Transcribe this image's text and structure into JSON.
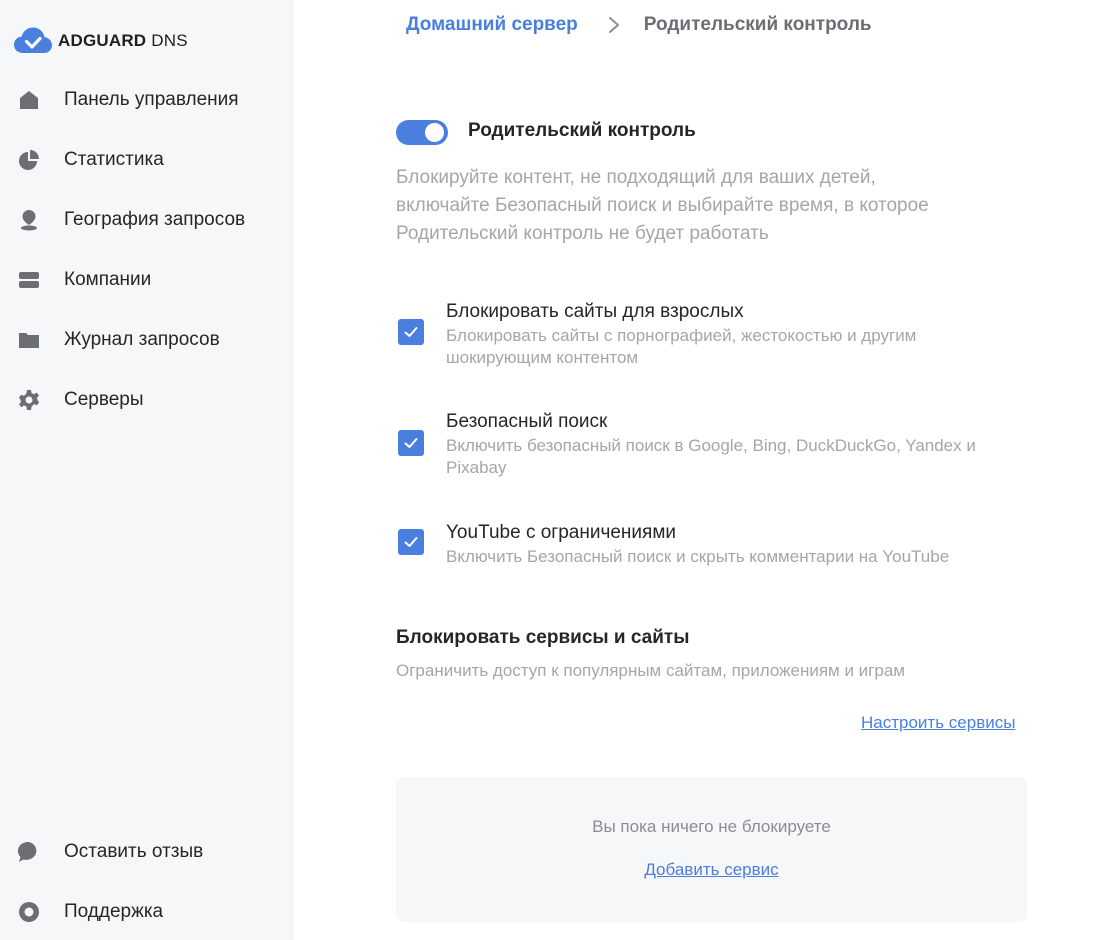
{
  "brand": {
    "name_bold": "ADGUARD",
    "name_light": "DNS",
    "logo_icon": "adguard-cloud-icon",
    "accent_color": "#4a7fe0"
  },
  "sidebar": {
    "items": [
      {
        "label": "Панель управления",
        "icon": "home-icon"
      },
      {
        "label": "Статистика",
        "icon": "pie-chart-icon"
      },
      {
        "label": "География запросов",
        "icon": "location-pin-icon"
      },
      {
        "label": "Компании",
        "icon": "server-stack-icon"
      },
      {
        "label": "Журнал запросов",
        "icon": "folder-icon"
      },
      {
        "label": "Серверы",
        "icon": "gear-icon"
      }
    ],
    "bottom_items": [
      {
        "label": "Оставить отзыв",
        "icon": "chat-bubble-icon"
      },
      {
        "label": "Поддержка",
        "icon": "lifebuoy-icon"
      }
    ]
  },
  "breadcrumb": {
    "parent": "Домашний сервер",
    "current": "Родительский контроль"
  },
  "parental": {
    "toggle_on": true,
    "title": "Родительский контроль",
    "description_lines": [
      "Блокируйте контент, не подходящий для ваших детей,",
      "включайте Безопасный поиск и выбирайте время, в которое",
      "Родительский контроль не будет работать"
    ]
  },
  "options": [
    {
      "checked": true,
      "title": "Блокировать сайты для взрослых",
      "desc_lines": [
        "Блокировать сайты с порнографией, жестокостью и другим",
        "шокирующим контентом"
      ]
    },
    {
      "checked": true,
      "title": "Безопасный поиск",
      "desc_lines": [
        "Включить безопасный поиск в Google, Bing, DuckDuckGo, Yandex и",
        "Pixabay"
      ]
    },
    {
      "checked": true,
      "title": "YouTube с ограничениями",
      "desc_lines": [
        "Включить Безопасный поиск и скрыть комментарии на YouTube"
      ]
    }
  ],
  "services": {
    "title": "Блокировать сервисы и сайты",
    "description": "Ограничить доступ к популярным сайтам, приложениям и играм",
    "configure_link": "Настроить сервисы",
    "empty_text": "Вы пока ничего не блокируете",
    "add_link": "Добавить сервис"
  }
}
